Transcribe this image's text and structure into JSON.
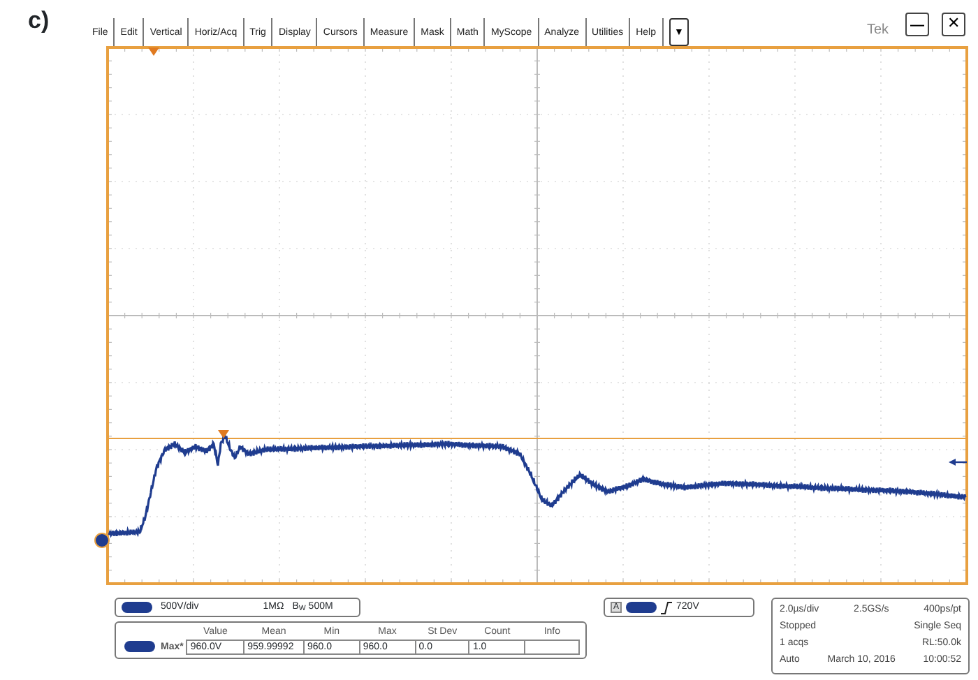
{
  "figure_label": "c)",
  "menu": [
    "File",
    "Edit",
    "Vertical",
    "Horiz/Acq",
    "Trig",
    "Display",
    "Cursors",
    "Measure",
    "Mask",
    "Math",
    "MyScope",
    "Analyze",
    "Utilities",
    "Help"
  ],
  "menu_dropdown": "▼",
  "brand": "Tek",
  "window_buttons": [
    {
      "kind": "minimize",
      "label": "—"
    },
    {
      "kind": "close",
      "label": "✕"
    }
  ],
  "channel": {
    "scale": "500V/div",
    "impedance": "1MΩ",
    "bandwidth": "B$_{W}$ 500M"
  },
  "measurements": {
    "columns": [
      "Value",
      "Mean",
      "Min",
      "Max",
      "St Dev",
      "Count",
      "Info"
    ],
    "rows": [
      {
        "label": "Max*",
        "cells": [
          "960.0V",
          "959.99992",
          "960.0",
          "960.0",
          "0.0",
          "1.0",
          ""
        ]
      }
    ]
  },
  "trigger": {
    "source": "A",
    "level": "720V"
  },
  "status": [
    [
      "2.0µs/div",
      "2.5GS/s",
      "400ps/pt"
    ],
    [
      "Stopped",
      "Single Seq"
    ],
    [
      "1 acqs",
      "RL:50.0k"
    ],
    [
      "Auto",
      "March 10, 2016",
      "10:00:52"
    ]
  ]
}
